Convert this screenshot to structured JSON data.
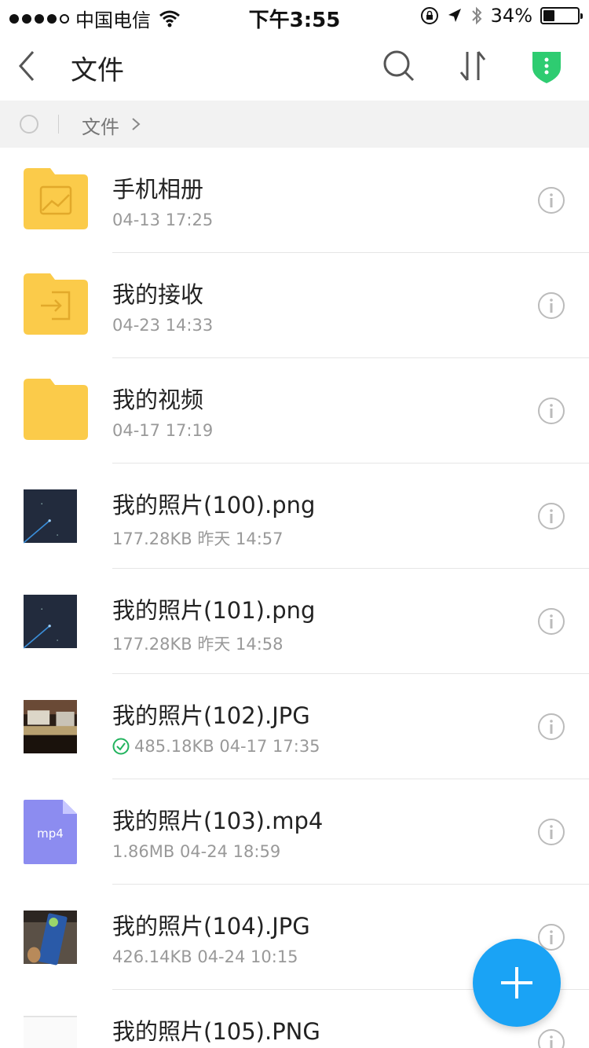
{
  "status_bar": {
    "carrier": "中国电信",
    "time": "下午3:55",
    "battery_text": "34%",
    "battery_level": 0.34
  },
  "nav": {
    "title": "文件"
  },
  "breadcrumb": {
    "label": "文件"
  },
  "colors": {
    "folder": "#fbcb4a",
    "fab": "#1aa3f5",
    "shield": "#2ecc71",
    "sync_check": "#22b35e",
    "mp4_icon": "#8c8cf0"
  },
  "files": [
    {
      "name": "手机相册",
      "meta": "04-13 17:25",
      "icon": "folder-album-icon"
    },
    {
      "name": "我的接收",
      "meta": "04-23 14:33",
      "icon": "folder-inbox-icon"
    },
    {
      "name": "我的视频",
      "meta": "04-17 17:19",
      "icon": "folder-icon"
    },
    {
      "name": "我的照片(100).png",
      "meta": "177.28KB 昨天 14:57",
      "icon": "image-thumbnail"
    },
    {
      "name": "我的照片(101).png",
      "meta": "177.28KB 昨天 14:58",
      "icon": "image-thumbnail"
    },
    {
      "name": "我的照片(102).JPG",
      "meta": "485.18KB 04-17 17:35",
      "icon": "image-thumbnail"
    },
    {
      "name": "我的照片(103).mp4",
      "meta": "1.86MB 04-24 18:59",
      "icon": "mp4-file-icon",
      "icon_label": "mp4"
    },
    {
      "name": "我的照片(104).JPG",
      "meta": "426.14KB 04-24 10:15",
      "icon": "image-thumbnail"
    },
    {
      "name": "我的照片(105).PNG",
      "meta": "",
      "icon": "image-thumbnail"
    }
  ]
}
